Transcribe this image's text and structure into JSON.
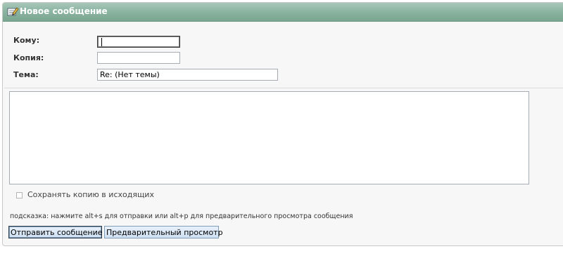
{
  "window": {
    "title": "Новое сообщение"
  },
  "form": {
    "to": {
      "label": "Кому:",
      "value": ""
    },
    "cc": {
      "label": "Копия:",
      "value": ""
    },
    "subject": {
      "label": "Тема:",
      "value": "Re: (Нет темы)"
    },
    "body": {
      "value": ""
    }
  },
  "options": {
    "save_copy_label": "Сохранять копию в исходящих",
    "save_copy_checked": false
  },
  "hint": "подсказка: нажмите alt+s для отправки или alt+p для предварительного просмотра сообщения",
  "buttons": {
    "send": "Отправить сообщение",
    "preview": "Предварительный просмотр"
  },
  "icons": {
    "title": "compose-message-icon"
  },
  "colors": {
    "titlebar": "#8ab3a0",
    "button_bg": "#cfe0f2",
    "button_border": "#7e9db9"
  }
}
